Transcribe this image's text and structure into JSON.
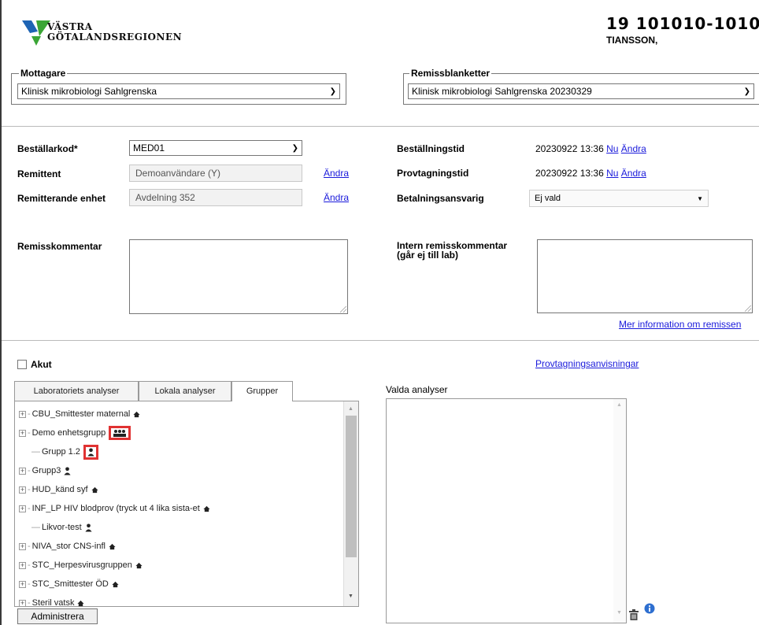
{
  "header": {
    "logo_line1": "VÄSTRA",
    "logo_line2": "GÖTALANDSREGIONEN",
    "patient_id": "19 101010-1010",
    "patient_name": "TIANSSON,"
  },
  "mottagare": {
    "legend": "Mottagare",
    "selected": "Klinisk mikrobiologi Sahlgrenska"
  },
  "remissblanketter": {
    "legend": "Remissblanketter",
    "selected": "Klinisk mikrobiologi Sahlgrenska 20230329"
  },
  "form": {
    "bestallarkod_label": "Beställarkod*",
    "bestallarkod_value": "MED01",
    "remittent_label": "Remittent",
    "remittent_value": "Demoanvändare (Y)",
    "remitterande_label": "Remitterande enhet",
    "remitterande_value": "Avdelning 352",
    "andra": "Ändra",
    "nu": "Nu",
    "bestallningstid_label": "Beställningstid",
    "bestallningstid_value": "20230922 13:36",
    "provtagningstid_label": "Provtagningstid",
    "provtagningstid_value": "20230922 13:36",
    "betalning_label": "Betalningsansvarig",
    "betalning_value": "Ej vald",
    "remisskommentar_label": "Remisskommentar",
    "intern_label_1": "Intern remisskommentar",
    "intern_label_2": "(går ej till lab)",
    "mer_info": "Mer information om remissen"
  },
  "akut_label": "Akut",
  "provtagningsanvisningar": "Provtagningsanvisningar",
  "tabs": [
    "Laboratoriets analyser",
    "Lokala analyser",
    "Grupper"
  ],
  "active_tab": "Grupper",
  "tree": [
    {
      "label": "CBU_Smittester maternal",
      "expand": true,
      "icon": "home-icon"
    },
    {
      "label": "Demo enhetsgrupp",
      "expand": true,
      "icon": "group-icon"
    },
    {
      "label": "Grupp 1.2",
      "expand": false,
      "icon": "user-icon"
    },
    {
      "label": "Grupp3",
      "expand": true,
      "icon": "user-icon"
    },
    {
      "label": "HUD_känd syf",
      "expand": true,
      "icon": "home-icon"
    },
    {
      "label": "INF_LP HIV blodprov (tryck ut 4 lika sista-et",
      "expand": true,
      "icon": "home-icon"
    },
    {
      "label": "Likvor-test",
      "expand": false,
      "icon": "user-icon"
    },
    {
      "label": "NIVA_stor CNS-infl",
      "expand": true,
      "icon": "home-icon"
    },
    {
      "label": "STC_Herpesvirusgruppen",
      "expand": true,
      "icon": "home-icon"
    },
    {
      "label": "STC_Smittester ÖD",
      "expand": true,
      "icon": "home-icon"
    },
    {
      "label": "Steril vatsk",
      "expand": true,
      "icon": "home-icon"
    }
  ],
  "valda_analyser_label": "Valda analyser",
  "administrera_button": "Administrera",
  "colors": {
    "link": "#1a1adb",
    "highlight": "#e03232",
    "logo_blue": "#1e64b4",
    "logo_green": "#3aa535"
  }
}
